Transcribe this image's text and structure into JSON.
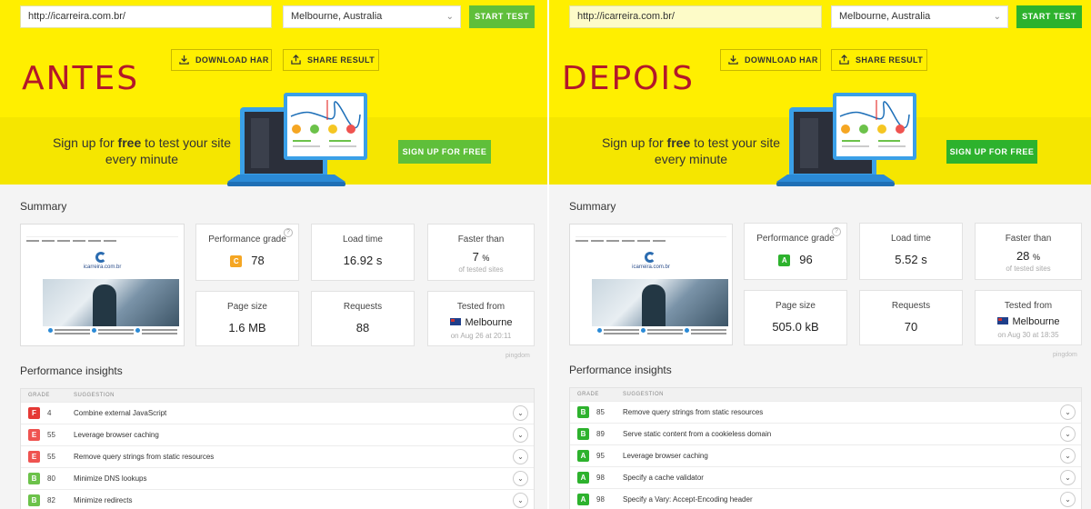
{
  "panels": [
    {
      "label": "ANTES",
      "url": "http://icarreira.com.br/",
      "location": "Melbourne, Australia",
      "start_test": "START TEST",
      "download_har": "DOWNLOAD HAR",
      "share_result": "SHARE RESULT",
      "promo_pre": "Sign up for ",
      "promo_bold": "free",
      "promo_post": " to test your site every minute",
      "signup": "SIGN UP FOR FREE",
      "summary_title": "Summary",
      "thumb_logo": "icarreira.com.br",
      "perf_grade_label": "Performance grade",
      "perf_grade_letter": "C",
      "perf_grade_color": "#f5a623",
      "perf_grade_value": "78",
      "load_time_label": "Load time",
      "load_time_value": "16.92 s",
      "faster_label": "Faster than",
      "faster_value": "7",
      "faster_unit": "%",
      "faster_sub": "of tested sites",
      "page_size_label": "Page size",
      "page_size_value": "1.6 MB",
      "requests_label": "Requests",
      "requests_value": "88",
      "tested_label": "Tested from",
      "tested_value": "Melbourne",
      "tested_sub": "on Aug 26 at 20:11",
      "pingdom": "pingdom",
      "insights_title": "Performance insights",
      "col_grade": "GRADE",
      "col_suggestion": "SUGGESTION",
      "insights": [
        {
          "grade": "F",
          "color": "#e53935",
          "score": "4",
          "text": "Combine external JavaScript"
        },
        {
          "grade": "E",
          "color": "#ef5350",
          "score": "55",
          "text": "Leverage browser caching"
        },
        {
          "grade": "E",
          "color": "#ef5350",
          "score": "55",
          "text": "Remove query strings from static resources"
        },
        {
          "grade": "B",
          "color": "#6cc24a",
          "score": "80",
          "text": "Minimize DNS lookups"
        },
        {
          "grade": "B",
          "color": "#6cc24a",
          "score": "82",
          "text": "Minimize redirects"
        }
      ]
    },
    {
      "label": "DEPOIS",
      "url": "http://icarreira.com.br/",
      "location": "Melbourne, Australia",
      "start_test": "START TEST",
      "download_har": "DOWNLOAD HAR",
      "share_result": "SHARE RESULT",
      "promo_pre": "Sign up for ",
      "promo_bold": "free",
      "promo_post": " to test your site every minute",
      "signup": "SIGN UP FOR FREE",
      "summary_title": "Summary",
      "thumb_logo": "icarreira.com.br",
      "perf_grade_label": "Performance grade",
      "perf_grade_letter": "A",
      "perf_grade_color": "#2db22d",
      "perf_grade_value": "96",
      "load_time_label": "Load time",
      "load_time_value": "5.52 s",
      "faster_label": "Faster than",
      "faster_value": "28",
      "faster_unit": "%",
      "faster_sub": "of tested sites",
      "page_size_label": "Page size",
      "page_size_value": "505.0 kB",
      "requests_label": "Requests",
      "requests_value": "70",
      "tested_label": "Tested from",
      "tested_value": "Melbourne",
      "tested_sub": "on Aug 30 at 18:35",
      "pingdom": "pingdom",
      "insights_title": "Performance insights",
      "col_grade": "GRADE",
      "col_suggestion": "SUGGESTION",
      "insights": [
        {
          "grade": "B",
          "color": "#2db22d",
          "score": "85",
          "text": "Remove query strings from static resources"
        },
        {
          "grade": "B",
          "color": "#2db22d",
          "score": "89",
          "text": "Serve static content from a cookieless domain"
        },
        {
          "grade": "A",
          "color": "#2db22d",
          "score": "95",
          "text": "Leverage browser caching"
        },
        {
          "grade": "A",
          "color": "#2db22d",
          "score": "98",
          "text": "Specify a cache validator"
        },
        {
          "grade": "A",
          "color": "#2db22d",
          "score": "98",
          "text": "Specify a Vary: Accept-Encoding header"
        }
      ]
    }
  ]
}
